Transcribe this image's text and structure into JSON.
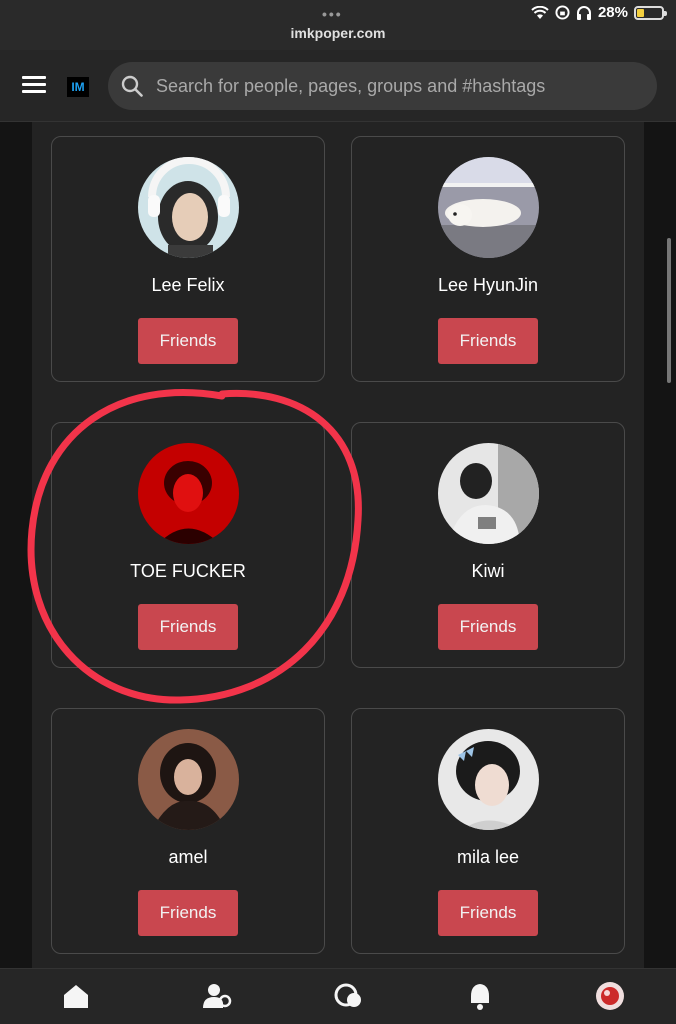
{
  "status": {
    "url": "imkpoper.com",
    "battery": "28%",
    "battery_level": 0.28,
    "dots": "•••"
  },
  "header": {
    "logo": "IM",
    "search_placeholder": "Search for people, pages, groups and #hashtags"
  },
  "friends": [
    {
      "name": "Lee Felix",
      "button": "Friends"
    },
    {
      "name": "Lee HyunJin",
      "button": "Friends"
    },
    {
      "name": "TOE FUCKER",
      "button": "Friends"
    },
    {
      "name": "Kiwi",
      "button": "Friends"
    },
    {
      "name": "amel",
      "button": "Friends"
    },
    {
      "name": "mila lee",
      "button": "Friends"
    }
  ],
  "bottom_nav": [
    "home-icon",
    "people-icon",
    "chat-icon",
    "bell-icon",
    "profile-avatar"
  ],
  "colors": {
    "accent": "#c9474f",
    "annotation": "#f2344a",
    "background": "#232323"
  }
}
